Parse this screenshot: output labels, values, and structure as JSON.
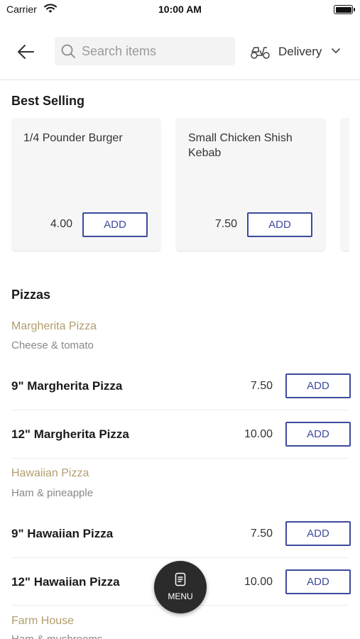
{
  "status_bar": {
    "carrier": "Carrier",
    "time": "10:00 AM"
  },
  "header": {
    "search": {
      "placeholder": "Search items",
      "value": ""
    },
    "fulfilment": {
      "selected": "Delivery"
    }
  },
  "best_selling": {
    "title": "Best Selling",
    "cards": [
      {
        "name": "1/4 Pounder Burger",
        "price": "4.00",
        "add_label": "ADD"
      },
      {
        "name": "Small Chicken Shish Kebab",
        "price": "7.50",
        "add_label": "ADD"
      }
    ]
  },
  "pizzas": {
    "title": "Pizzas",
    "groups": [
      {
        "name": "Margherita Pizza",
        "description": "Cheese & tomato",
        "items": [
          {
            "name": "9\" Margherita Pizza",
            "price": "7.50",
            "add_label": "ADD"
          },
          {
            "name": "12\" Margherita Pizza",
            "price": "10.00",
            "add_label": "ADD"
          }
        ]
      },
      {
        "name": "Hawaiian Pizza",
        "description": "Ham & pineapple",
        "items": [
          {
            "name": "9\" Hawaiian Pizza",
            "price": "7.50",
            "add_label": "ADD"
          },
          {
            "name": "12\" Hawaiian Pizza",
            "price": "10.00",
            "add_label": "ADD"
          }
        ]
      },
      {
        "name": "Farm House",
        "description": "Ham & mushrooms"
      }
    ]
  },
  "fab": {
    "label": "MENU"
  },
  "colors": {
    "accent": "#3d4a9c",
    "group_name": "#b29d6c",
    "fab_bg": "#2b2b2b"
  }
}
